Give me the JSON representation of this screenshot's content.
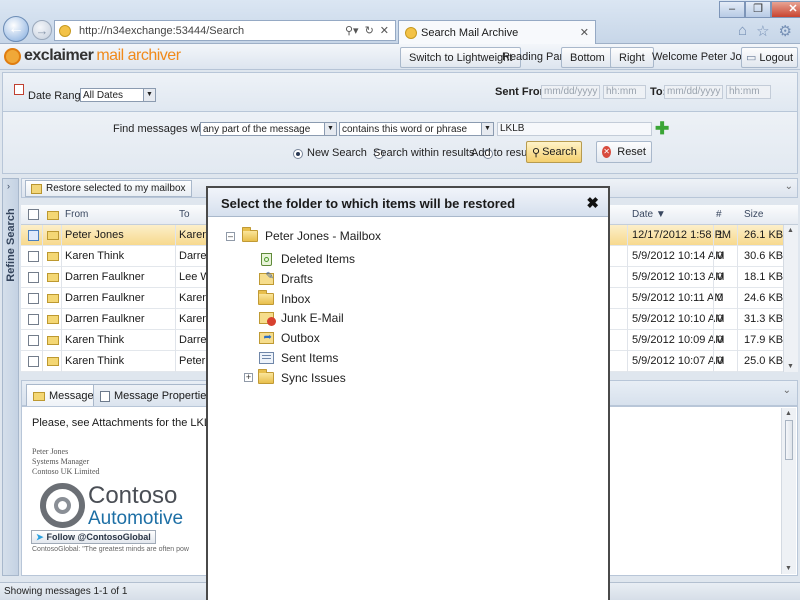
{
  "browser": {
    "url": "http://n34exchange:53444/Search",
    "tab_title": "Search Mail Archive",
    "window_controls": [
      "minimize",
      "maximize",
      "close"
    ],
    "toolbar_icons": [
      "home-icon",
      "favorites-star-icon",
      "settings-gear-icon"
    ]
  },
  "app": {
    "logo_part1": "exclaimer",
    "logo_part2": "mail archiver",
    "switch_button": "Switch to Lightweight",
    "reading_pane_label": "Reading Pane:",
    "bottom_button": "Bottom",
    "right_button": "Right",
    "welcome": "Welcome Peter Jones!",
    "logout_button": "Logout"
  },
  "search": {
    "date_range_label": "Date Range:",
    "date_range_value": "All Dates",
    "sent_from_label": "Sent From:",
    "date_placeholder": "mm/dd/yyyy",
    "time_placeholder": "hh:mm",
    "to_label": "To:",
    "find_label": "Find messages where",
    "scope_value": "any part of the message",
    "condition_value": "contains this word or phrase",
    "term_value": "LKLB",
    "radio_new": "New Search",
    "radio_within": "Search within results",
    "radio_add": "Add to results",
    "search_button": "Search",
    "reset_button": "Reset",
    "selected_mode": "new"
  },
  "sidebar": {
    "refine_label": "Refine Search"
  },
  "list": {
    "restore_button": "Restore selected to my mailbox",
    "columns": {
      "from": "From",
      "to": "To",
      "date": "Date",
      "attach": "#",
      "size": "Size"
    },
    "rows": [
      {
        "from": "Peter Jones",
        "to": "Karen",
        "date": "12/17/2012 1:58 PM",
        "attach": "1",
        "size": "26.1 KB",
        "selected": true
      },
      {
        "from": "Karen Think",
        "to": "Darren",
        "date": "5/9/2012 10:14 AM",
        "attach": "0",
        "size": "30.6 KB"
      },
      {
        "from": "Darren Faulkner",
        "to": "Lee W",
        "date": "5/9/2012 10:13 AM",
        "attach": "0",
        "size": "18.1 KB"
      },
      {
        "from": "Darren Faulkner",
        "to": "Karen",
        "date": "5/9/2012 10:11 AM",
        "attach": "0",
        "size": "24.6 KB"
      },
      {
        "from": "Darren Faulkner",
        "to": "Karen",
        "date": "5/9/2012 10:10 AM",
        "attach": "0",
        "size": "31.3 KB"
      },
      {
        "from": "Karen Think",
        "to": "Darren",
        "date": "5/9/2012 10:09 AM",
        "attach": "0",
        "size": "17.9 KB"
      },
      {
        "from": "Karen Think",
        "to": "Peter",
        "date": "5/9/2012 10:07 AM",
        "attach": "0",
        "size": "25.0 KB"
      }
    ]
  },
  "preview": {
    "tab_message": "Message",
    "tab_properties": "Message Properties",
    "body_text": "Please, see Attachments for the LKLB s",
    "sig_name": "Peter Jones",
    "sig_title": "Systems Manager",
    "sig_company": "Contoso UK Limited",
    "brand_line1": "Contoso",
    "brand_line2": "Automotive",
    "follow_button": "Follow @ContosoGlobal",
    "tagline": "ContosoGlobal: \"The greatest minds are often pow"
  },
  "status": {
    "text": "Showing messages 1-1 of 1"
  },
  "modal": {
    "title": "Select the folder to which items will be restored",
    "root": "Peter Jones - Mailbox",
    "folders": [
      {
        "name": "Deleted Items",
        "icon": "deleted-items-icon"
      },
      {
        "name": "Drafts",
        "icon": "drafts-icon"
      },
      {
        "name": "Inbox",
        "icon": "inbox-icon"
      },
      {
        "name": "Junk E-Mail",
        "icon": "junk-email-icon"
      },
      {
        "name": "Outbox",
        "icon": "outbox-icon"
      },
      {
        "name": "Sent Items",
        "icon": "sent-items-icon"
      },
      {
        "name": "Sync Issues",
        "icon": "folder-icon"
      }
    ]
  },
  "colors": {
    "accent_orange": "#f08a1c",
    "selected_row": "#f7d98e",
    "header_blue": "#d6e0ee",
    "brand_blue": "#1d6fa5"
  }
}
